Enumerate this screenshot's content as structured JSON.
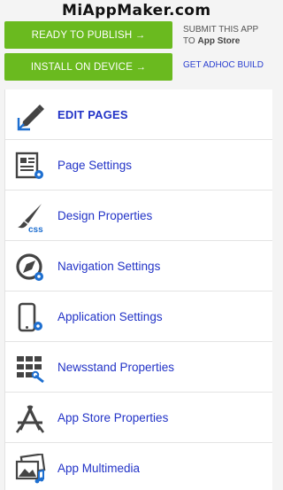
{
  "brand": {
    "logo_text": "MiAppMaker.com"
  },
  "actions": {
    "publish_label": "READY TO PUBLISH →",
    "install_label": "INSTALL ON DEVICE →",
    "submit_line1": "SUBMIT THIS APP",
    "submit_to": "TO",
    "submit_store": "App Store",
    "adhoc_label": "GET ADHOC BUILD"
  },
  "menu": {
    "items": [
      {
        "label": "EDIT PAGES",
        "icon": "pencil-icon"
      },
      {
        "label": "Page Settings",
        "icon": "page-settings-icon"
      },
      {
        "label": "Design Properties",
        "icon": "brush-css-icon"
      },
      {
        "label": "Navigation Settings",
        "icon": "compass-gear-icon"
      },
      {
        "label": "Application Settings",
        "icon": "phone-gear-icon"
      },
      {
        "label": "Newsstand Properties",
        "icon": "newsstand-icon"
      },
      {
        "label": "App Store Properties",
        "icon": "app-store-icon"
      },
      {
        "label": "App Multimedia",
        "icon": "multimedia-icon"
      }
    ]
  },
  "colors": {
    "accent_green": "#6aba1f",
    "link_blue": "#2233c7",
    "gear_blue": "#1e6fd0"
  }
}
